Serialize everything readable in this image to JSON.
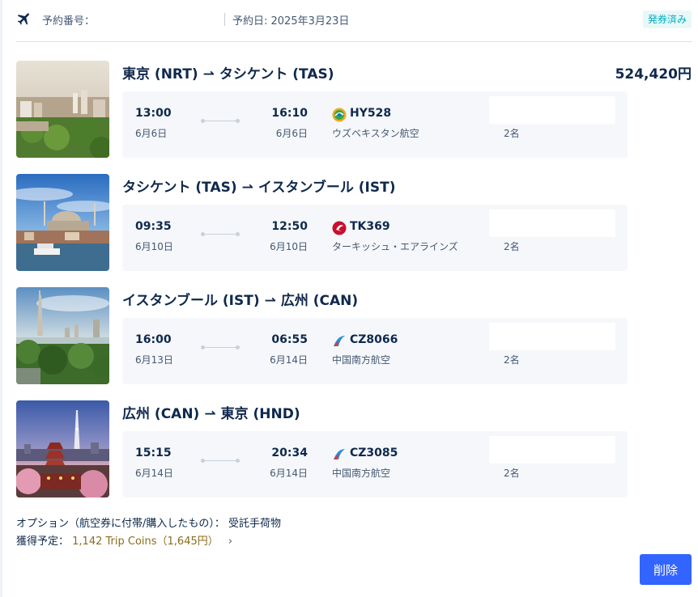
{
  "header": {
    "booking_number_label": "予約番号：",
    "booking_date": "予約日: 2025年3月23日",
    "status": "発券済み"
  },
  "segments": [
    {
      "route_from": "東京 (NRT)",
      "route_to": "タシケント (TAS)",
      "price": "524,420円",
      "dep_time": "13:00",
      "dep_date": "6月6日",
      "arr_time": "16:10",
      "arr_date": "6月6日",
      "flight_no": "HY528",
      "airline": "ウズベキスタン航空",
      "airline_icon": "uzbekistan-airways-logo-icon",
      "pax": "2名",
      "image": "tashkent-city-photo"
    },
    {
      "route_from": "タシケント (TAS)",
      "route_to": "イスタンブール (IST)",
      "dep_time": "09:35",
      "dep_date": "6月10日",
      "arr_time": "12:50",
      "arr_date": "6月10日",
      "flight_no": "TK369",
      "airline": "ターキッシュ・エアラインズ",
      "airline_icon": "turkish-airlines-logo-icon",
      "pax": "2名",
      "image": "istanbul-mosque-photo"
    },
    {
      "route_from": "イスタンブール (IST)",
      "route_to": "広州 (CAN)",
      "dep_time": "16:00",
      "dep_date": "6月13日",
      "arr_time": "06:55",
      "arr_date": "6月14日",
      "flight_no": "CZ8066",
      "airline": "中国南方航空",
      "airline_icon": "china-southern-logo-icon",
      "pax": "2名",
      "image": "guangzhou-tower-photo"
    },
    {
      "route_from": "広州 (CAN)",
      "route_to": "東京 (HND)",
      "dep_time": "15:15",
      "dep_date": "6月14日",
      "arr_time": "20:34",
      "arr_date": "6月14日",
      "flight_no": "CZ3085",
      "airline": "中国南方航空",
      "airline_icon": "china-southern-logo-icon",
      "pax": "2名",
      "image": "tokyo-skytree-photo"
    }
  ],
  "options": {
    "label": "オプション（航空券に付帯/購入したもの）：",
    "value": "受託手荷物"
  },
  "coins": {
    "label": "獲得予定：",
    "value": "1,142 Trip Coins（1,645円）"
  },
  "actions": {
    "delete_label": "削除"
  },
  "colors": {
    "accent": "#3264ff",
    "status": "#06aebd",
    "coin": "#8a6d1b"
  }
}
